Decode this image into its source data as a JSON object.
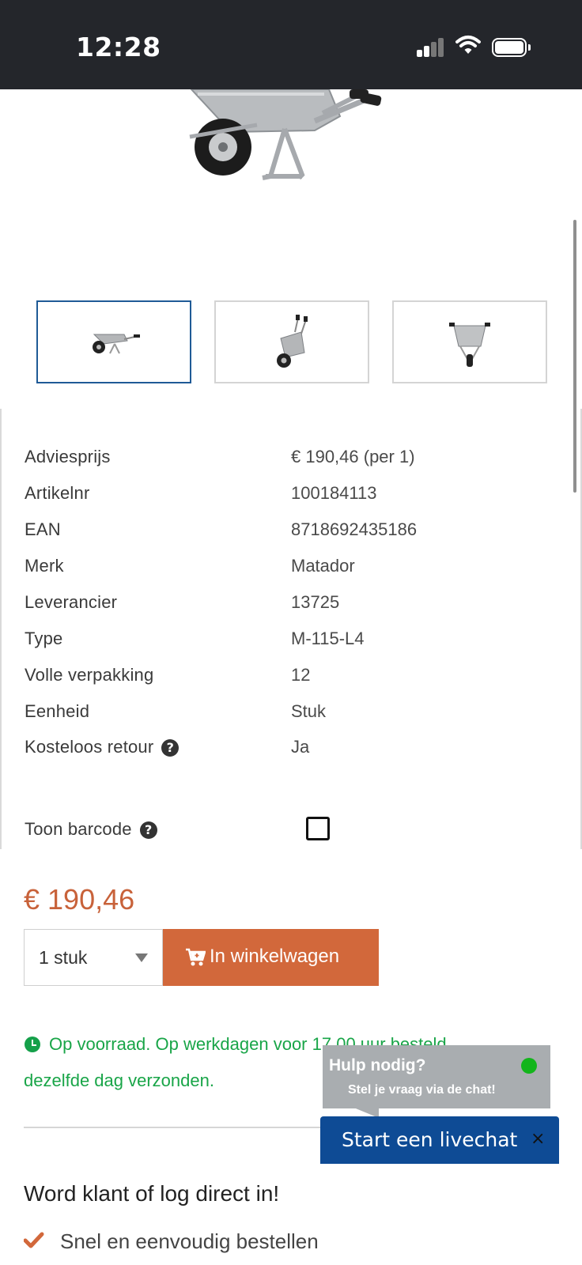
{
  "status_bar": {
    "time": "12:28"
  },
  "product": {
    "thumbnails": [
      {
        "icon": "wheelbarrow-side",
        "selected": true
      },
      {
        "icon": "wheelbarrow-tilted",
        "selected": false
      },
      {
        "icon": "wheelbarrow-back",
        "selected": false
      }
    ]
  },
  "specs": [
    {
      "label": "Adviesprijs",
      "value": "€ 190,46 (per 1)"
    },
    {
      "label": "Artikelnr",
      "value": "100184113"
    },
    {
      "label": "EAN",
      "value": "8718692435186"
    },
    {
      "label": "Merk",
      "value": "Matador"
    },
    {
      "label": "Leverancier",
      "value": "13725"
    },
    {
      "label": "Type",
      "value": "M-115-L4"
    },
    {
      "label": "Volle verpakking",
      "value": "12"
    },
    {
      "label": "Eenheid",
      "value": "Stuk"
    },
    {
      "label": "Kosteloos retour",
      "value": "Ja"
    }
  ],
  "barcode": {
    "label": "Toon barcode",
    "checked": false
  },
  "purchase": {
    "price": "€ 190,46",
    "quantity": "1 stuk",
    "cart_button": "In winkelwagen",
    "accent_color": "#d2683b"
  },
  "stock": {
    "line1": "Op voorraad. Op werkdagen voor 17.00 uur besteld",
    "line2": "dezelfde dag verzonden.",
    "color": "#19a548"
  },
  "chat": {
    "title": "Hulp nodig?",
    "subtitle": "Stel je vraag via de chat!",
    "button": "Start een livechat",
    "close": "×",
    "button_color": "#0e4b95"
  },
  "promo": {
    "title": "Word klant of log direct in!",
    "benefits": [
      "Snel en eenvoudig bestellen"
    ]
  }
}
